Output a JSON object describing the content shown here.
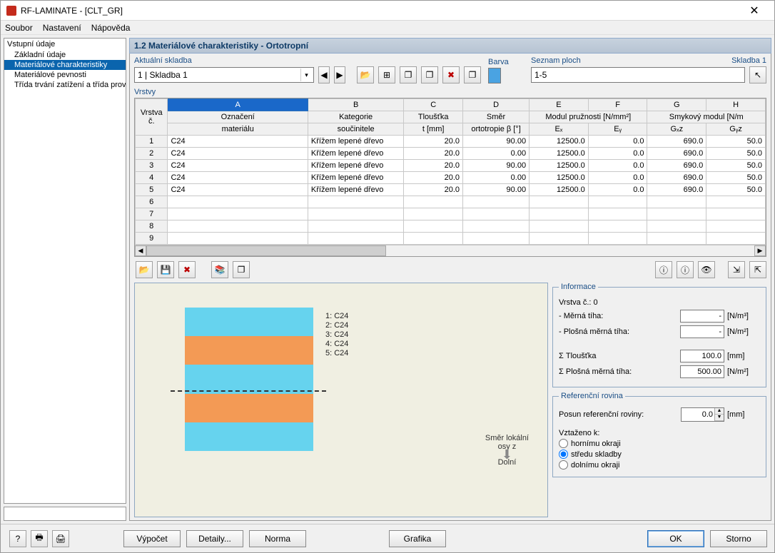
{
  "window": {
    "title": "RF-LAMINATE - [CLT_GR]"
  },
  "menu": [
    "Soubor",
    "Nastavení",
    "Nápověda"
  ],
  "nav": {
    "root": "Vstupní údaje",
    "items": [
      "Základní údaje",
      "Materiálové charakteristiky",
      "Materiálové pevnosti",
      "Třída trvání zatížení a třída prov"
    ],
    "selected_index": 1
  },
  "panel_title": "1.2 Materiálové charakteristiky - Ortotropní",
  "top": {
    "skladba_label": "Aktuální skladba",
    "skladba_value": "1 | Skladba 1",
    "barva_label": "Barva",
    "seznam_label": "Seznam ploch",
    "seznam_value": "1-5",
    "skladba_link": "Skladba 1"
  },
  "table": {
    "title": "Vrstvy",
    "letters": [
      "A",
      "B",
      "C",
      "D",
      "E",
      "F",
      "G",
      "H"
    ],
    "group_headers": {
      "vrstva": "Vrstva",
      "c": "č.",
      "oznaceni_top": "Označení",
      "oznaceni_bot": "materiálu",
      "kategorie_top": "Kategorie",
      "kategorie_bot": "součinitele",
      "tloustka_top": "Tloušťka",
      "tloustka_bot": "t [mm]",
      "smer_top": "Směr",
      "smer_bot": "ortotropie β [°]",
      "modul_group": "Modul pružnosti [N/mm²]",
      "ex": "Eₓ",
      "ey": "Eᵧ",
      "smyk_group": "Smykový modul [N/m",
      "gxz": "Gₓz",
      "gyz": "Gᵧz"
    },
    "rows": [
      {
        "n": "1",
        "mat": "C24",
        "kat": "Křížem lepené dřevo",
        "t": "20.0",
        "b": "90.00",
        "ex": "12500.0",
        "ey": "0.0",
        "gxz": "690.0",
        "gyz": "50.0"
      },
      {
        "n": "2",
        "mat": "C24",
        "kat": "Křížem lepené dřevo",
        "t": "20.0",
        "b": "0.00",
        "ex": "12500.0",
        "ey": "0.0",
        "gxz": "690.0",
        "gyz": "50.0"
      },
      {
        "n": "3",
        "mat": "C24",
        "kat": "Křížem lepené dřevo",
        "t": "20.0",
        "b": "90.00",
        "ex": "12500.0",
        "ey": "0.0",
        "gxz": "690.0",
        "gyz": "50.0"
      },
      {
        "n": "4",
        "mat": "C24",
        "kat": "Křížem lepené dřevo",
        "t": "20.0",
        "b": "0.00",
        "ex": "12500.0",
        "ey": "0.0",
        "gxz": "690.0",
        "gyz": "50.0"
      },
      {
        "n": "5",
        "mat": "C24",
        "kat": "Křížem lepené dřevo",
        "t": "20.0",
        "b": "90.00",
        "ex": "12500.0",
        "ey": "0.0",
        "gxz": "690.0",
        "gyz": "50.0"
      }
    ],
    "empty_rows": [
      "6",
      "7",
      "8",
      "9"
    ]
  },
  "preview": {
    "labels": [
      "1: C24",
      "2: C24",
      "3: C24",
      "4: C24",
      "5: C24"
    ],
    "axis_top": "Směr lokální",
    "axis_mid": "osy z",
    "axis_bot": "Dolní"
  },
  "info": {
    "legend": "Informace",
    "vrstva_c": "Vrstva č.: 0",
    "merna_tiha_lbl": "- Měrná tíha:",
    "merna_tiha_val": "-",
    "merna_tiha_unit": "[N/m³]",
    "plosna_lbl": "- Plošná měrná tíha:",
    "plosna_val": "-",
    "plosna_unit": "[N/m²]",
    "sigma_t_lbl": "Σ Tloušťka",
    "sigma_t_val": "100.0",
    "sigma_t_unit": "[mm]",
    "sigma_p_lbl": "Σ Plošná měrná tíha:",
    "sigma_p_val": "500.00",
    "sigma_p_unit": "[N/m²]"
  },
  "refplane": {
    "legend": "Referenční rovina",
    "posun_lbl": "Posun referenční roviny:",
    "posun_val": "0.0",
    "posun_unit": "[mm]",
    "vztazeno": "Vztaženo k:",
    "r1": "hornímu okraji",
    "r2": "středu skladby",
    "r3": "dolnímu okraji",
    "selected": 1
  },
  "footer": {
    "vypocet": "Výpočet",
    "detaily": "Detaily...",
    "norma": "Norma",
    "grafika": "Grafika",
    "ok": "OK",
    "storno": "Storno"
  },
  "icons": {
    "open": "📂",
    "save": "💾",
    "delete": "✖",
    "copy": "❐",
    "excel": "⊞",
    "prev": "◀",
    "next": "▶",
    "new": "✚",
    "info": "ⓘ",
    "eye": "👁",
    "lib": "📚",
    "pick": "↖",
    "exp1": "⇲",
    "exp2": "⇱",
    "help": "?",
    "print1": "🖶",
    "print2": "🖨"
  }
}
